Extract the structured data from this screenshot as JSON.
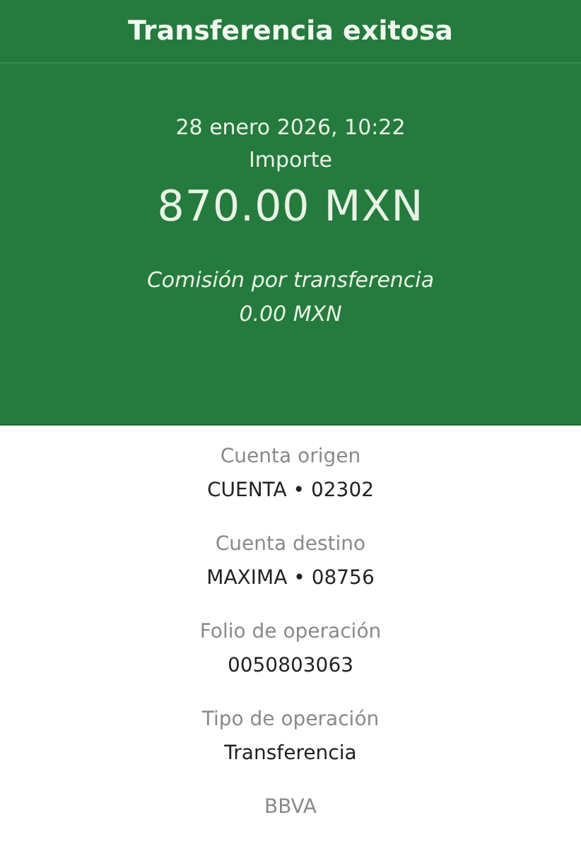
{
  "header": {
    "title": "Transferencia exitosa"
  },
  "summary": {
    "date": "28 enero 2026, 10:22",
    "amount_label": "Importe",
    "amount": "870.00 MXN",
    "fee_label": "Comisión por transferencia",
    "fee": "0.00 MXN"
  },
  "details": [
    {
      "label": "Cuenta origen",
      "value": "CUENTA • 02302"
    },
    {
      "label": "Cuenta destino",
      "value": "MAXIMA • 08756"
    },
    {
      "label": "Folio de operación",
      "value": "0050803063"
    },
    {
      "label": "Tipo de operación",
      "value": "Transferencia"
    }
  ],
  "footer": {
    "bank": "BBVA"
  }
}
